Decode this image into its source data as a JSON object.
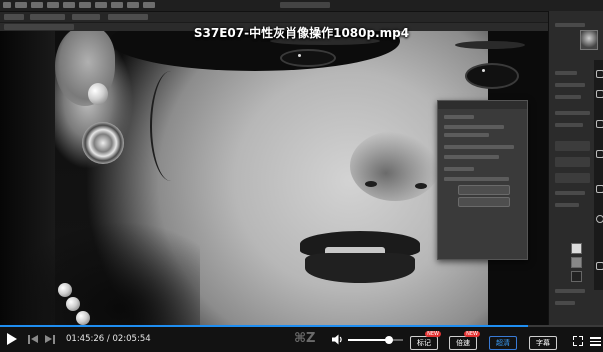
{
  "video": {
    "title": "S37E07-中性灰肖像操作1080p.mp4",
    "progress": 0.875
  },
  "controls": {
    "time_current": "01:45:26",
    "time_separator": "/",
    "time_total": "02:05:54",
    "watermark": "⌘Z",
    "volume": 0.75,
    "buttons": {
      "bookmark": "标记",
      "speed": "倍速",
      "quality": "超清",
      "subtitle": "字幕"
    },
    "badges": {
      "bookmark": "NEW",
      "speed": "NEW"
    }
  },
  "colors": {
    "accent": "#1f8ef1",
    "active_button": "#3aa0ff",
    "badge": "#e33333"
  },
  "icons": {
    "play": "play-icon",
    "prev": "previous-icon",
    "next": "next-icon",
    "volume": "volume-icon",
    "fullscreen": "fullscreen-icon",
    "menu": "menu-icon"
  }
}
